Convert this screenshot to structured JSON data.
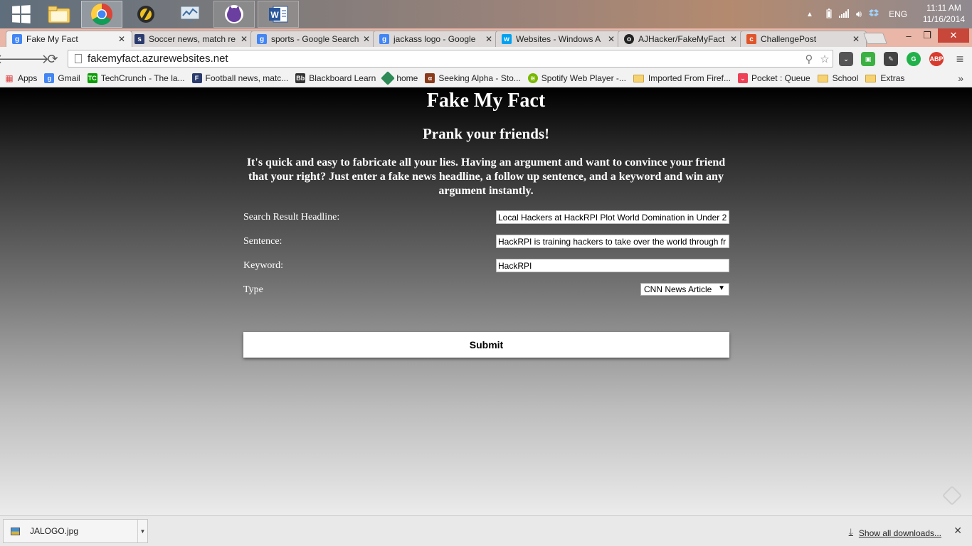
{
  "taskbar": {
    "apps": [
      {
        "name": "start",
        "icon": "windows-logo-icon"
      },
      {
        "name": "file-explorer",
        "icon": "folder-icon"
      },
      {
        "name": "chrome",
        "icon": "chrome-icon"
      },
      {
        "name": "app-3",
        "icon": "app-icon"
      },
      {
        "name": "app-4",
        "icon": "monitor-icon"
      },
      {
        "name": "app-5",
        "icon": "cat-icon"
      },
      {
        "name": "word",
        "icon": "word-icon",
        "letter": "W"
      }
    ],
    "language": "ENG",
    "time": "11:11 AM",
    "date": "11/16/2014"
  },
  "tabs": [
    {
      "title": "Fake My Fact",
      "active": true,
      "favicon_color": "#4285f4",
      "favicon_letter": "g"
    },
    {
      "title": "Soccer news, match re",
      "active": false,
      "favicon_color": "#2a3b6e",
      "favicon_letter": "s"
    },
    {
      "title": "sports - Google Search",
      "active": false,
      "favicon_color": "#4285f4",
      "favicon_letter": "g"
    },
    {
      "title": "jackass logo - Google",
      "active": false,
      "favicon_color": "#4285f4",
      "favicon_letter": "g"
    },
    {
      "title": "Websites - Windows A",
      "active": false,
      "favicon_color": "#00a1f1",
      "favicon_letter": "w"
    },
    {
      "title": "AJHacker/FakeMyFact",
      "active": false,
      "favicon_color": "#222222",
      "favicon_letter": "o"
    },
    {
      "title": "ChallengePost",
      "active": false,
      "favicon_color": "#e0542a",
      "favicon_letter": "c"
    }
  ],
  "window_controls": {
    "minimize": "–",
    "maximize": "❐",
    "close": "✕"
  },
  "address_bar": {
    "url": "fakemyfact.azurewebsites.net"
  },
  "bookmarks": [
    {
      "label": "Apps",
      "icon_color": "#d44"
    },
    {
      "label": "Gmail",
      "icon_color": "#4285f4"
    },
    {
      "label": "TechCrunch - The la...",
      "icon_color": "#0a9e01"
    },
    {
      "label": "Football news, matc...",
      "icon_color": "#2a3b6e"
    },
    {
      "label": "Blackboard Learn",
      "icon_color": "#333333"
    },
    {
      "label": "home",
      "icon_color": "#2e8b57"
    },
    {
      "label": "Seeking Alpha - Sto...",
      "icon_color": "#8b3a1a"
    },
    {
      "label": "Spotify Web Player -...",
      "icon_color": "#7ab800"
    },
    {
      "label": "Imported From Firef...",
      "folder": true
    },
    {
      "label": "Pocket : Queue",
      "icon_color": "#ee4056"
    },
    {
      "label": "School",
      "folder": true
    },
    {
      "label": "Extras",
      "folder": true
    }
  ],
  "page": {
    "title": "Fake My Fact",
    "subtitle": "Prank your friends!",
    "intro": "It's quick and easy to fabricate all your lies. Having an argument and want to convince your friend that your right? Just enter a fake news headline, a follow up sentence, and a keyword and win any argument instantly.",
    "form": {
      "headline_label": "Search Result Headline:",
      "headline_value": "Local Hackers at HackRPI Plot World Domination in Under 2",
      "sentence_label": "Sentence:",
      "sentence_value": "HackRPI is training hackers to take over the world through fr",
      "keyword_label": "Keyword:",
      "keyword_value": "HackRPI",
      "type_label": "Type",
      "type_selected": "CNN News Article",
      "submit_label": "Submit"
    }
  },
  "downloads": {
    "file": "JALOGO.jpg",
    "show_all": "Show all downloads..."
  }
}
